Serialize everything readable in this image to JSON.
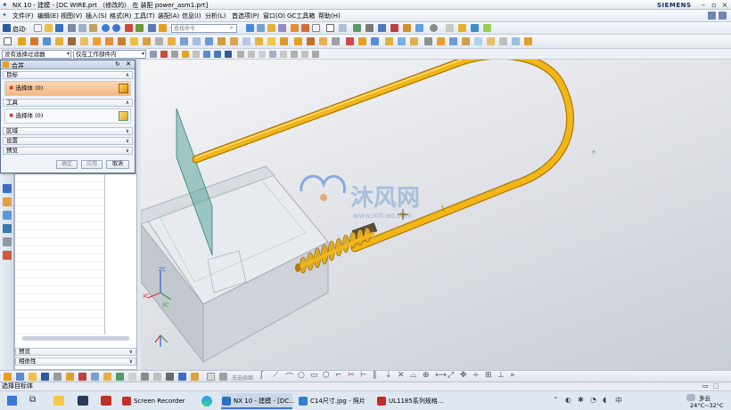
{
  "window": {
    "title": "NX 10 - 建模 - [DC WIRE.prt （修改的） 在 装配 power_asm1.prt]",
    "brand": "SIEMENS",
    "controls": [
      "–",
      "▫",
      "×"
    ]
  },
  "menu": {
    "start": "启动·",
    "items": [
      "文件(F)",
      "编辑(E)",
      "视图(V)",
      "插入(S)",
      "格式(R)",
      "工具(T)",
      "装配(A)",
      "信息(I)",
      "分析(L)",
      "首选项(P)",
      "窗口(O)",
      "GC工具箱",
      "帮助(H)"
    ]
  },
  "toolbar": {
    "search_placeholder": "查找命令"
  },
  "filters": {
    "selection_filter": "没有选择过滤器",
    "scope": "仅在工作部件内"
  },
  "dialog": {
    "title": "合并",
    "target_label": "目标",
    "target_select": "选择体 (0)",
    "tool_label": "工具",
    "tool_select": "选择体 (0)",
    "region_label": "区域",
    "settings_label": "设置",
    "preview_label": "预览",
    "ok_label": "确定",
    "apply_label": "应用",
    "cancel_label": "取消"
  },
  "navigator": {
    "preview_label": "预览",
    "dependency_label": "相依性"
  },
  "viewport": {
    "watermark_title": "沐风网",
    "watermark_url": "www.mfcad.com",
    "axis_zc": "ZC",
    "axis_yc": "YC",
    "axis_xc": "XC"
  },
  "bottom_toolbar": {
    "curve_rule_label": "无选择面"
  },
  "status": {
    "text": "选择目标体"
  },
  "taskbar": {
    "apps": [
      {
        "label": "Screen Recorder",
        "color": "#c0302a"
      },
      {
        "label": "NX 10 - 建模 - [DC...",
        "color": "#2d6fc0"
      },
      {
        "label": "C14尺寸.jpg - 照片",
        "color": "#2f7fd6"
      },
      {
        "label": "UL1185系列规格...",
        "color": "#c62828"
      }
    ],
    "weather": "多云",
    "temperature": "24°C~32°C"
  },
  "colors": {
    "wire": "#f2b619",
    "wire_dark": "#b07a00",
    "accent": "#3b78d8"
  }
}
